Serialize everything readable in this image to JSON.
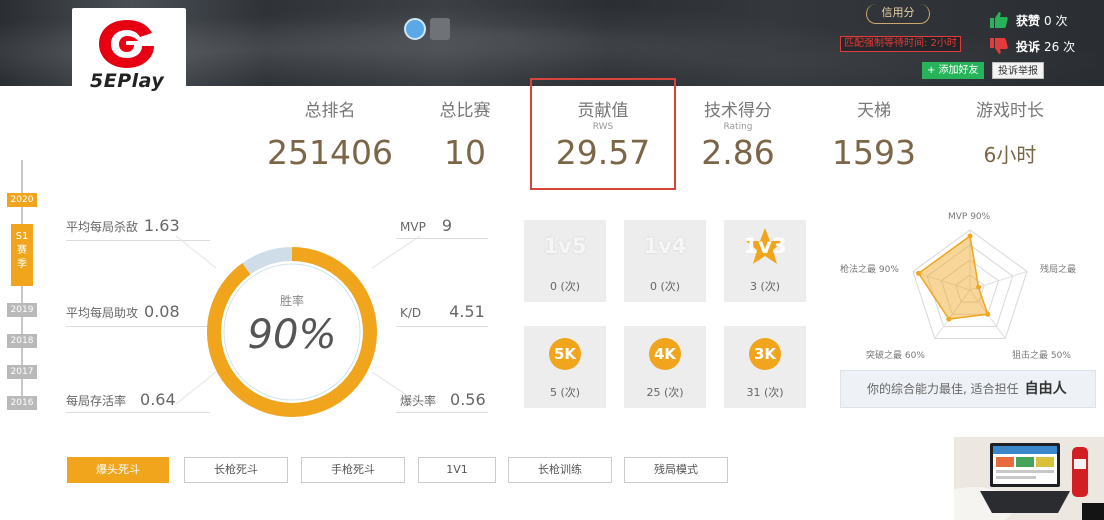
{
  "header": {
    "logo_text": "5EPlay",
    "credit_label": "信用分",
    "wait_notice": "匹配强制等待时间: 2小时",
    "add_friend": "+ 添加好友",
    "report": "投诉举报",
    "likes_label": "获赞",
    "likes_value": "0 次",
    "complaints_label": "投诉",
    "complaints_value": "26 次"
  },
  "stats": [
    {
      "label": "总排名",
      "sub": "",
      "value": "251406"
    },
    {
      "label": "总比赛",
      "sub": "",
      "value": "10"
    },
    {
      "label": "贡献值",
      "sub": "RWS",
      "value": "29.57"
    },
    {
      "label": "技术得分",
      "sub": "Rating",
      "value": "2.86"
    },
    {
      "label": "天梯",
      "sub": "",
      "value": "1593"
    },
    {
      "label": "游戏时长",
      "sub": "",
      "value": "6小时"
    }
  ],
  "timeline": {
    "years": [
      "2020",
      "2019",
      "2018",
      "2017",
      "2016"
    ],
    "season": [
      "S1",
      "赛",
      "季"
    ]
  },
  "player": {
    "avg_kills_label": "平均每局杀敌",
    "avg_kills": "1.63",
    "avg_assists_label": "平均每局助攻",
    "avg_assists": "0.08",
    "survival_label": "每局存活率",
    "survival": "0.64",
    "mvp_label": "MVP",
    "mvp": "9",
    "kd_label": "K/D",
    "kd": "4.51",
    "headshot_label": "爆头率",
    "headshot": "0.56",
    "winrate_label": "胜率",
    "winrate": "90%",
    "winrate_fraction": 0.9
  },
  "multikills": [
    {
      "badge": "1v5",
      "count": "0 (次)",
      "style": "faded"
    },
    {
      "badge": "1v4",
      "count": "0 (次)",
      "style": "faded"
    },
    {
      "badge": "1v3",
      "count": "3 (次)",
      "style": "star"
    },
    {
      "badge": "5K",
      "count": "5 (次)",
      "style": "circle"
    },
    {
      "badge": "4K",
      "count": "25 (次)",
      "style": "circle"
    },
    {
      "badge": "3K",
      "count": "31 (次)",
      "style": "circle"
    }
  ],
  "radar": {
    "labels": [
      "MVP 90%",
      "残局之最",
      "狙击之最 50%",
      "突破之最 60%",
      "枪法之最 90%"
    ],
    "values": [
      0.9,
      0.15,
      0.5,
      0.6,
      0.9
    ],
    "color": "#f0a51d"
  },
  "verdict": {
    "text": "你的综合能力最佳, 适合担任",
    "role": "自由人"
  },
  "tabs": [
    "爆头死斗",
    "长枪死斗",
    "手枪死斗",
    "1V1",
    "长枪训练",
    "残局模式"
  ],
  "colors": {
    "accent": "#f0a51d",
    "highlight": "#d9433a",
    "value": "#7b6648"
  }
}
